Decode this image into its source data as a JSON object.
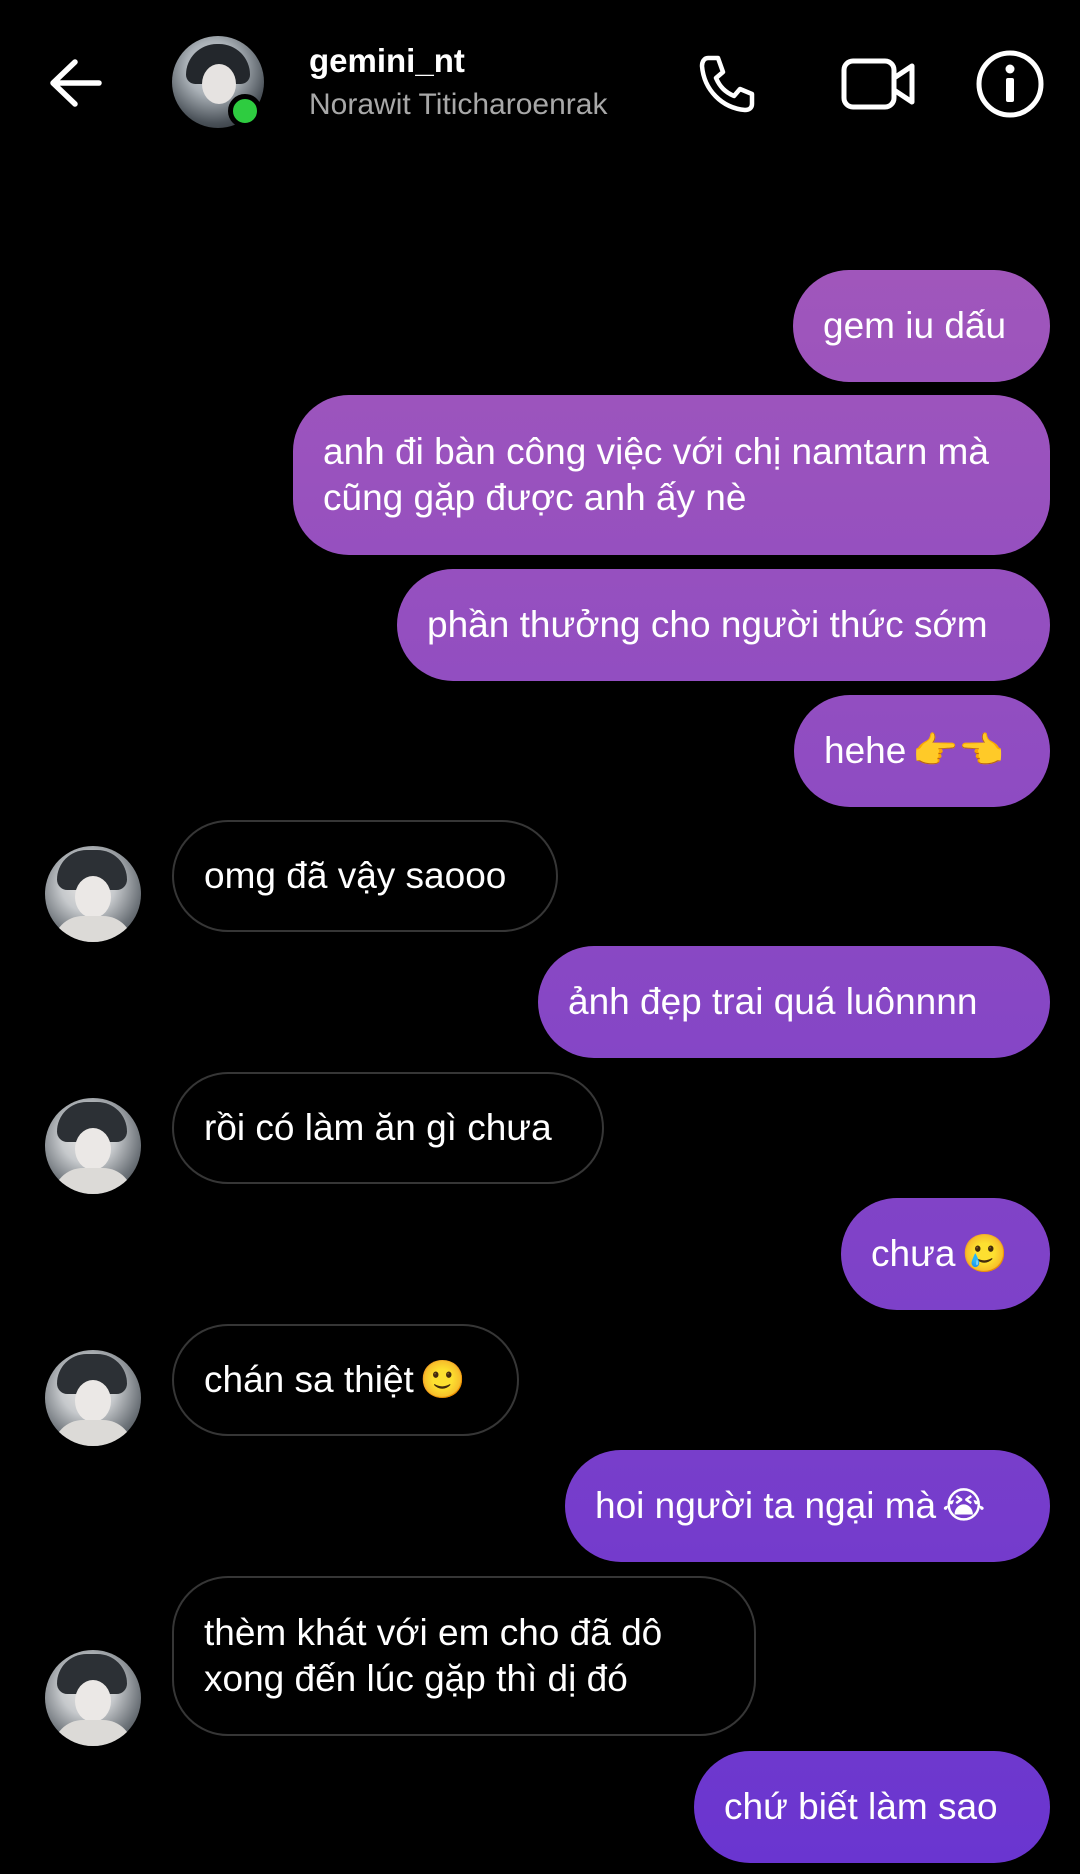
{
  "header": {
    "username": "gemini_nt",
    "fullname": "Norawit Titicharoenrak"
  },
  "colors": {
    "background": "#000000",
    "sent_gradient_top": "#a95cb8",
    "sent_gradient_bottom": "#6a35d0",
    "received_border": "#363636",
    "online": "#2ecc40"
  },
  "icons": {
    "back": "arrow-left",
    "call": "phone",
    "video": "video-camera",
    "info": "info-circle"
  },
  "messages": [
    {
      "side": "sent",
      "text": "gem iu dấu"
    },
    {
      "side": "sent",
      "text": "anh đi bàn công việc với chị namtarn mà cũng gặp được anh ấy nè"
    },
    {
      "side": "sent",
      "text": "phần thưởng cho người thức sớm"
    },
    {
      "side": "sent",
      "text": "hehe",
      "emoji": "👉👈"
    },
    {
      "side": "received",
      "text": "omg đã vậy saooo"
    },
    {
      "side": "sent",
      "text": "ảnh đẹp trai quá luônnnn"
    },
    {
      "side": "received",
      "text": "rồi có làm ăn gì chưa"
    },
    {
      "side": "sent",
      "text": "chưa",
      "emoji": "🥲"
    },
    {
      "side": "received",
      "text": "chán sa thiệt",
      "emoji": "🙂"
    },
    {
      "side": "sent",
      "text": "hoi người ta ngại mà",
      "emoji": "😭"
    },
    {
      "side": "received",
      "text": "thèm khát với em cho đã dô xong đến lúc gặp thì dị đó"
    },
    {
      "side": "sent",
      "text": "chứ biết làm sao"
    }
  ]
}
